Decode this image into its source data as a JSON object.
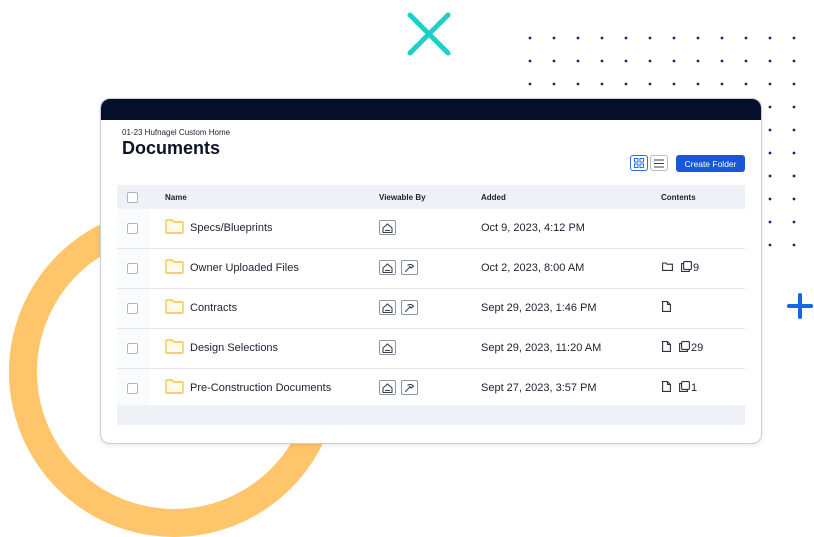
{
  "breadcrumb": "01-23 Hufnagel Custom Home",
  "page_title": "Documents",
  "toolbar": {
    "grid_view_icon": "grid-icon",
    "list_view_icon": "list-icon",
    "create_folder_label": "Create Folder",
    "accent_color": "#1857d6"
  },
  "table": {
    "headers": {
      "name": "Name",
      "viewable_by": "Viewable By",
      "added": "Added",
      "contents": "Contents"
    },
    "rows": [
      {
        "name": "Specs/Blueprints",
        "viewable_by": [
          "owner-icon"
        ],
        "added": "Oct 9, 2023, 4:12 PM",
        "contents": []
      },
      {
        "name": "Owner Uploaded Files",
        "viewable_by": [
          "owner-icon",
          "subcontractor-icon"
        ],
        "added": "Oct 2, 2023, 8:00 AM",
        "contents": [
          {
            "icon": "folder-icon",
            "count": ""
          },
          {
            "icon": "files-icon",
            "count": "9"
          }
        ]
      },
      {
        "name": "Contracts",
        "viewable_by": [
          "owner-icon",
          "subcontractor-icon"
        ],
        "added": "Sept 29, 2023, 1:46 PM",
        "contents": [
          {
            "icon": "file-icon",
            "count": ""
          }
        ]
      },
      {
        "name": "Design Selections",
        "viewable_by": [
          "owner-icon"
        ],
        "added": "Sept 29, 2023, 11:20 AM",
        "contents": [
          {
            "icon": "file-icon",
            "count": ""
          },
          {
            "icon": "files-icon",
            "count": "29"
          }
        ]
      },
      {
        "name": "Pre-Construction Documents",
        "viewable_by": [
          "owner-icon",
          "subcontractor-icon"
        ],
        "added": "Sept 27, 2023, 3:57 PM",
        "contents": [
          {
            "icon": "file-icon",
            "count": ""
          },
          {
            "icon": "files-icon",
            "count": "1"
          }
        ]
      }
    ]
  },
  "colors": {
    "header_bar": "#050f2c",
    "folder": "#f2c744",
    "decor_ring": "#ffc56b",
    "decor_x": "#1fcfc7",
    "decor_plus": "#1565e8",
    "decor_dots": "#0d2b6e"
  }
}
